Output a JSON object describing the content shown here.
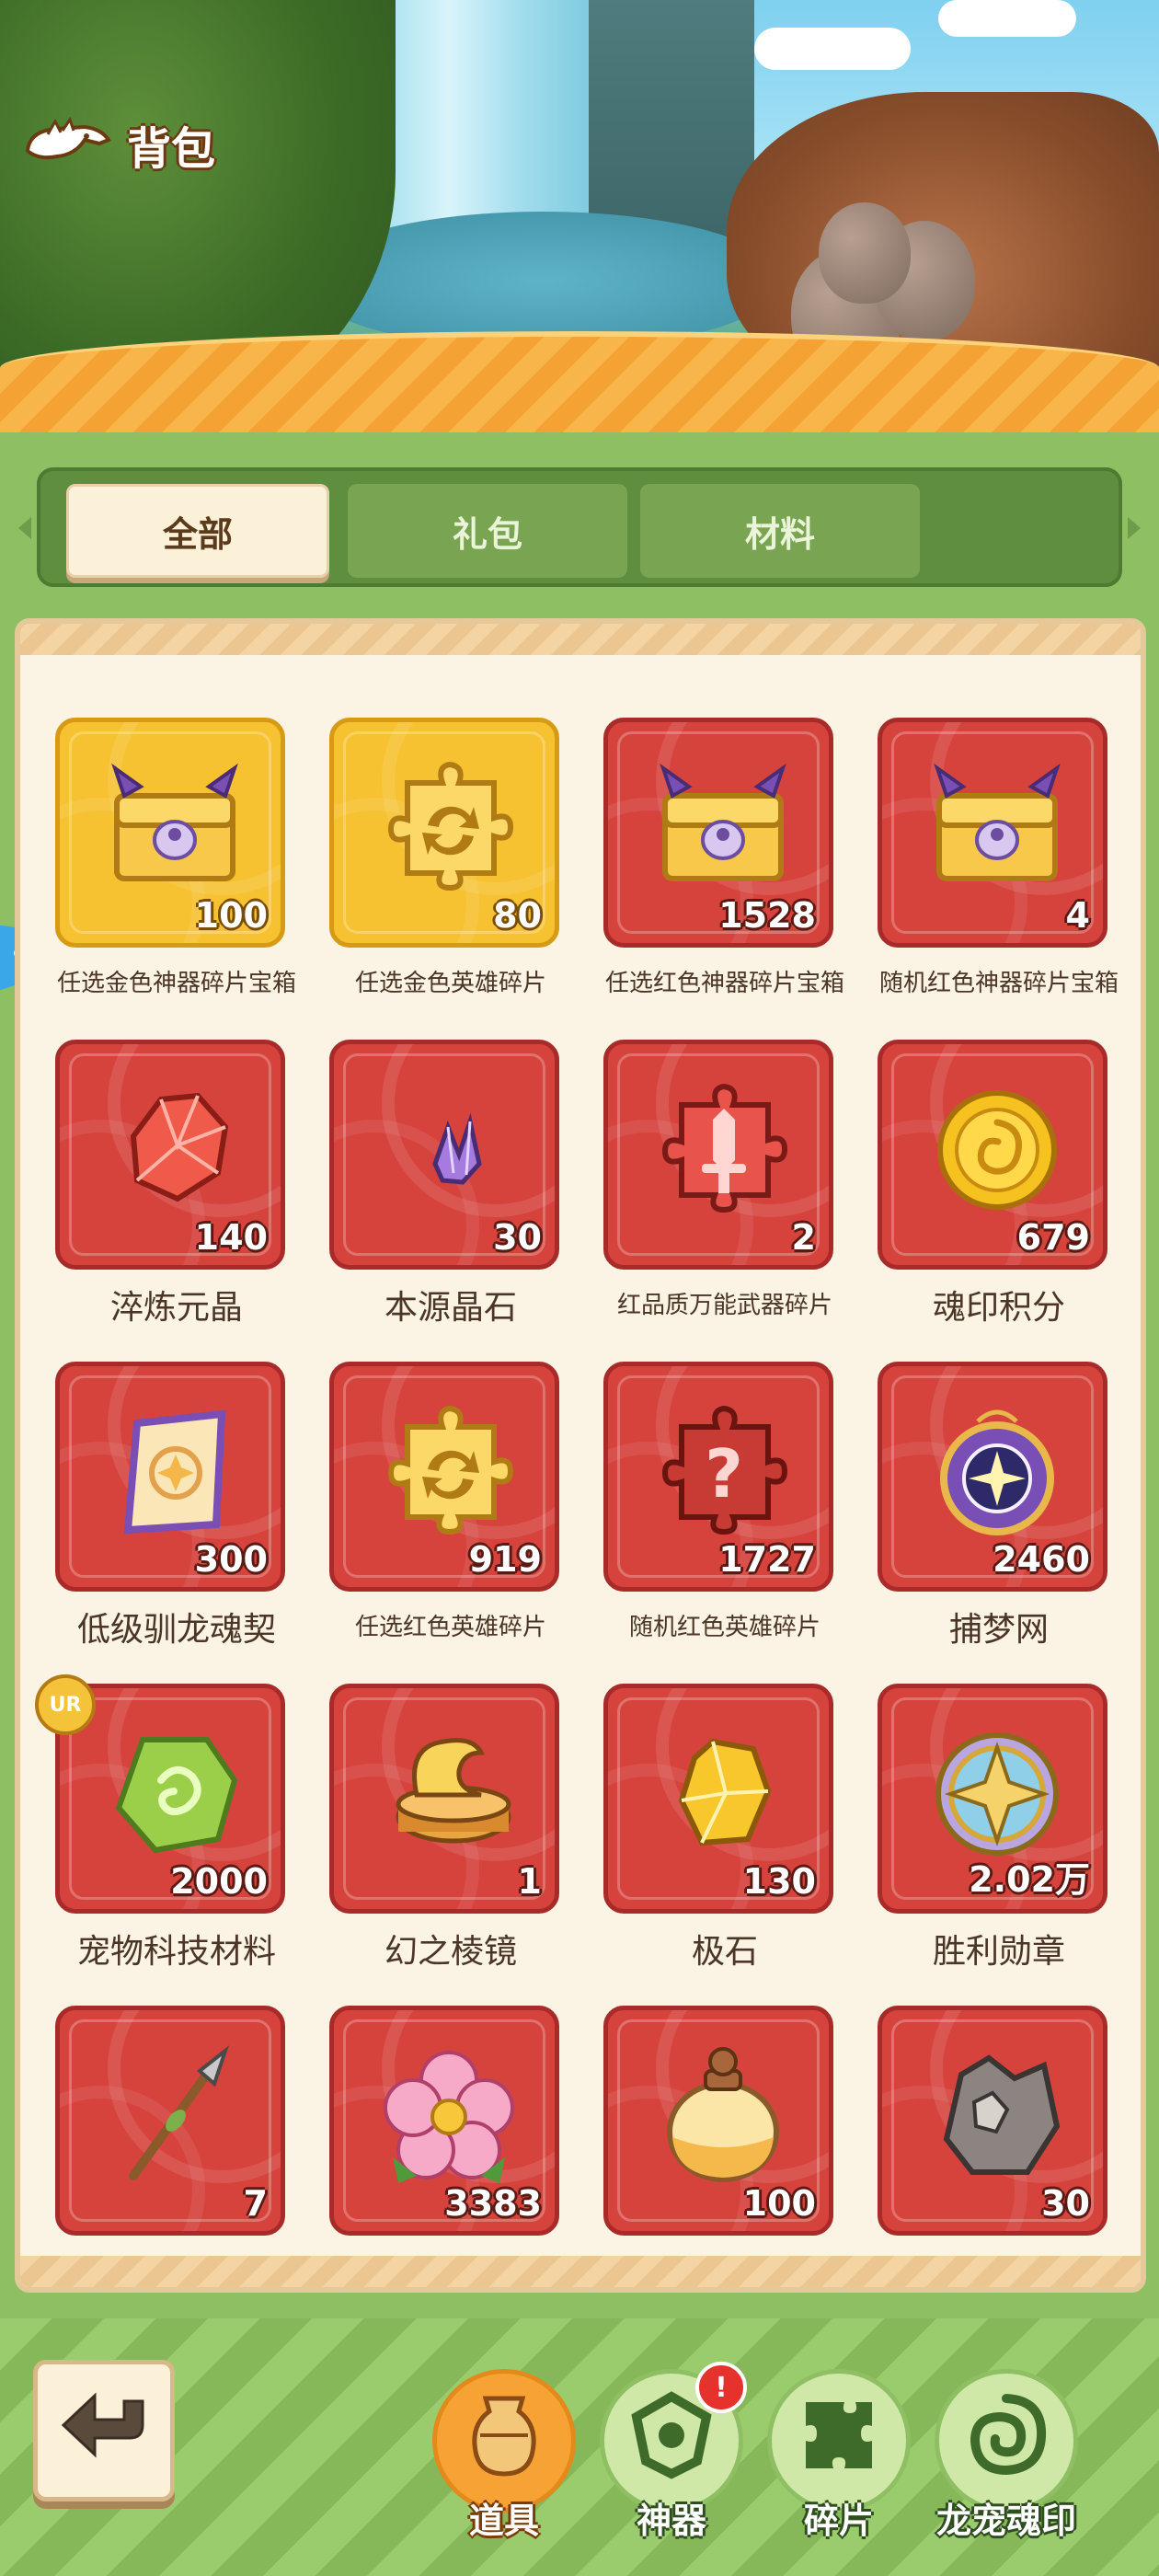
{
  "header": {
    "title": "背包"
  },
  "tabs": [
    {
      "label": "全部",
      "active": true
    },
    {
      "label": "礼包",
      "active": false
    },
    {
      "label": "材料",
      "active": false
    }
  ],
  "items": [
    {
      "name": "任选金色神器碎片宝箱",
      "count": "100",
      "frame": "gold",
      "icon": "chest-icon"
    },
    {
      "name": "任选金色英雄碎片",
      "count": "80",
      "frame": "gold",
      "icon": "puzzle-swap-icon"
    },
    {
      "name": "任选红色神器碎片宝箱",
      "count": "1528",
      "frame": "red",
      "icon": "chest-icon"
    },
    {
      "name": "随机红色神器碎片宝箱",
      "count": "4",
      "frame": "red",
      "icon": "chest-icon"
    },
    {
      "name": "淬炼元晶",
      "count": "140",
      "frame": "red",
      "icon": "red-crystal-icon"
    },
    {
      "name": "本源晶石",
      "count": "30",
      "frame": "red",
      "icon": "purple-crystal-icon"
    },
    {
      "name": "红品质万能武器碎片",
      "count": "2",
      "frame": "red",
      "icon": "sword-puzzle-icon"
    },
    {
      "name": "魂印积分",
      "count": "679",
      "frame": "red",
      "icon": "coin-icon"
    },
    {
      "name": "低级驯龙魂契",
      "count": "300",
      "frame": "red",
      "icon": "scroll-icon"
    },
    {
      "name": "任选红色英雄碎片",
      "count": "919",
      "frame": "red",
      "icon": "puzzle-swap-icon"
    },
    {
      "name": "随机红色英雄碎片",
      "count": "1727",
      "frame": "red",
      "icon": "puzzle-question-icon"
    },
    {
      "name": "捕梦网",
      "count": "2460",
      "frame": "red",
      "icon": "dreamcatcher-icon"
    },
    {
      "name": "宠物科技材料",
      "count": "2000",
      "frame": "red",
      "icon": "green-stone-icon",
      "badge": "UR"
    },
    {
      "name": "幻之棱镜",
      "count": "1",
      "frame": "red",
      "icon": "golden-cup-icon"
    },
    {
      "name": "极石",
      "count": "130",
      "frame": "red",
      "icon": "yellow-gem-icon"
    },
    {
      "name": "胜利勋章",
      "count": "2.02万",
      "frame": "red",
      "icon": "medal-icon"
    },
    {
      "name": "",
      "count": "7",
      "frame": "red",
      "icon": "spear-icon"
    },
    {
      "name": "",
      "count": "3383",
      "frame": "red",
      "icon": "flower-icon"
    },
    {
      "name": "",
      "count": "100",
      "frame": "red",
      "icon": "potion-jar-icon"
    },
    {
      "name": "",
      "count": "30",
      "frame": "red",
      "icon": "ore-icon"
    }
  ],
  "bottom_nav": [
    {
      "label": "道具",
      "active": true,
      "icon": "vase-icon",
      "alert": ""
    },
    {
      "label": "神器",
      "active": false,
      "icon": "artifact-icon",
      "alert": "!"
    },
    {
      "label": "碎片",
      "active": false,
      "icon": "shard-icon",
      "alert": ""
    },
    {
      "label": "龙宠魂印",
      "active": false,
      "icon": "swirl-seal-icon",
      "alert": ""
    }
  ],
  "colors": {
    "red_frame": "#d6433d",
    "gold_frame": "#f7c232",
    "panel": "#fbf3e3",
    "green_bg": "#8fbf63",
    "nav_active": "#f6a235"
  }
}
